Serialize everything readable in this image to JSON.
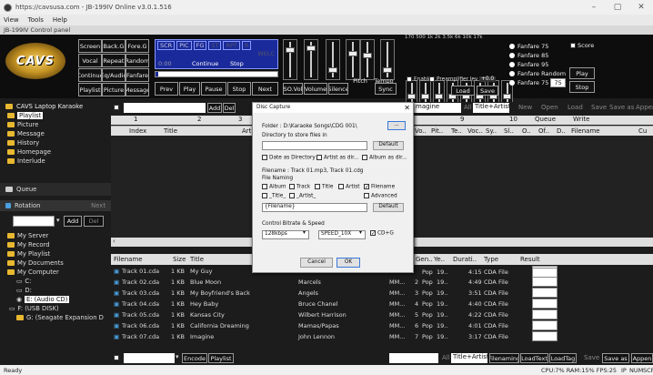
{
  "window": {
    "url": "https://cavsusa.com - JB-199IV Online v3.0.1.516"
  },
  "menu": [
    "View",
    "Tools",
    "Help"
  ],
  "subtitle": "JB-199IV Control panel",
  "logo": "CAVS",
  "controls": {
    "row1": [
      "Screen",
      "Back.G",
      "Fore.G"
    ],
    "row2": [
      "Vocal",
      "Repeat",
      "Random"
    ],
    "row3": [
      "Continue",
      "Eq/Audio",
      "Fanfare"
    ],
    "row4": [
      "Playlist",
      "Picture",
      "Message"
    ],
    "display_tabs": [
      "SCR",
      "PIC",
      "FG",
      "ST",
      "RPT",
      "R"
    ],
    "display_text": "WELC",
    "display_time": "0:00",
    "display_status": "Continue",
    "display_status2": "Stop",
    "transport": [
      "Prev",
      "Play",
      "Pause",
      "Stop",
      "Next"
    ],
    "sliders": [
      "SO.Vol",
      "Volume",
      "Silence",
      "Pitch",
      "Tempo",
      "Sync"
    ],
    "eq_freqs": "170 500 1k 2k 3.5k 6k 10k 17k",
    "enable": "Enable",
    "preamp": "Preamplifier lev",
    "preamp_val": "+0.0",
    "load": "Load",
    "save": "Save",
    "fanfare": [
      "Fanfare 75",
      "Fanfare 85",
      "Fanfare 95",
      "Fanfare Random",
      "Fanfare 75"
    ],
    "fanfare_value": "75",
    "score": "Score",
    "play": "Play",
    "stop": "Stop"
  },
  "left": {
    "title": "CAVS Laptop Karaoke",
    "items": [
      "Playlist",
      "Picture",
      "Message",
      "History",
      "Homepage",
      "Interlude"
    ],
    "queue": "Queue",
    "rotation": "Rotation",
    "next": "Next",
    "add": "Add",
    "del": "Del",
    "tree": [
      "My Server",
      "My Record",
      "My Playlist",
      "My Documents",
      "My Computer",
      "C:",
      "D:",
      "E: (Audio CD)",
      "F: (USB DISK)",
      "G: (Seagate Expansion D"
    ]
  },
  "topgrid": {
    "add": "Add",
    "del": "Del",
    "tabs": [
      "1",
      "2",
      "3",
      "4",
      "9",
      "10"
    ],
    "cols": [
      "Index",
      "Title",
      "Arti"
    ],
    "rightcols": [
      "Vo..",
      "Pit..",
      "Te..",
      "Voc..",
      "Sy..",
      "Sl..",
      "O..",
      "Of..",
      "D..",
      "Filename",
      "Cu"
    ],
    "search": "magine",
    "all": "All",
    "titleartist": "Title+Artist",
    "new": "New",
    "open": "Open",
    "load": "Load",
    "save": "Save",
    "saveas": "Save as",
    "append": "Appen",
    "queue": "Queue",
    "write": "Write"
  },
  "bottomgrid": {
    "cols": [
      "Filename",
      "Size",
      "Title",
      "Gen..",
      "Ye..",
      "Durati..",
      "Type",
      "Result"
    ],
    "rows": [
      {
        "file": "Track 01.cda",
        "size": "1 KB",
        "title": "My Guy",
        "artist": "",
        "album": "",
        "n": "",
        "gen": "",
        "year": "",
        "dur": "",
        "type": ""
      },
      {
        "file": "Track 02.cda",
        "size": "1 KB",
        "title": "Blue Moon",
        "artist": "Marcels",
        "album": "MM...",
        "n": "2",
        "gen": "Pop",
        "year": "19..",
        "dur": "4:49",
        "type": "CDA File"
      },
      {
        "file": "Track 03.cda",
        "size": "1 KB",
        "title": "My Boyfriend's Back",
        "artist": "Angels",
        "album": "MM...",
        "n": "3",
        "gen": "Pop",
        "year": "19..",
        "dur": "3:51",
        "type": "CDA File"
      },
      {
        "file": "Track 04.cda",
        "size": "1 KB",
        "title": "Hey Baby",
        "artist": "Bruce Chanel",
        "album": "MM...",
        "n": "4",
        "gen": "Pop",
        "year": "19..",
        "dur": "4:40",
        "type": "CDA File"
      },
      {
        "file": "Track 05.cda",
        "size": "1 KB",
        "title": "Kansas City",
        "artist": "Wilbert Harrison",
        "album": "MM...",
        "n": "5",
        "gen": "Pop",
        "year": "19..",
        "dur": "4:22",
        "type": "CDA File"
      },
      {
        "file": "Track 06.cda",
        "size": "1 KB",
        "title": "California Dreaming",
        "artist": "Mamas/Papas",
        "album": "MM...",
        "n": "6",
        "gen": "Pop",
        "year": "19..",
        "dur": "4:01",
        "type": "CDA File"
      },
      {
        "file": "Track 07.cda",
        "size": "1 KB",
        "title": "Imagine",
        "artist": "John Lennon",
        "album": "MM...",
        "n": "7",
        "gen": "Pop",
        "year": "19..",
        "dur": "3:17",
        "type": "CDA File"
      }
    ],
    "row1_gen": "Pop",
    "row1_year": "19..",
    "row1_dur": "4:15",
    "row1_type": "CDA File",
    "encode": "Encode",
    "playlist": "Playlist",
    "all": "All",
    "titleartist": "Title+Artist",
    "filenaming": "Filenaming",
    "loadtext": "LoadText",
    "loadtag": "LoadTag",
    "save": "Save",
    "saveas": "Save as",
    "append": "Appen"
  },
  "dialog": {
    "title": "Disc Capture",
    "folder": "Folder : D:\\Karaoke Songs\\CDG 001\\",
    "browse": "...",
    "dir_label": "Directory to store files in",
    "default": "Default",
    "date_dir": "Date as Directory",
    "artist_dir": "Artist as dir...",
    "album_dir": "Album as dir...",
    "filename": "Filename : Track 01.mp3, Track 01.cdg",
    "naming": "File Naming",
    "opts": [
      "Album",
      "Track",
      "Title",
      "Artist",
      "Filename"
    ],
    "title_opt": "_Title_",
    "artist_opt": "_Artist_",
    "advanced": "Advanced",
    "pattern": "{Filename}",
    "default2": "Default",
    "bitrate_label": "Control Bitrate & Speed",
    "bitrate": "128kbps",
    "speed": "SPEED_10X",
    "cdg": "CD+G",
    "cancel": "Cancel",
    "ok": "OK"
  },
  "status": {
    "left": "Ready",
    "right": "CPU:7% RAM:15% FPS:25",
    "ip": "IP",
    "num": "NUM",
    "scr": "SCR"
  }
}
